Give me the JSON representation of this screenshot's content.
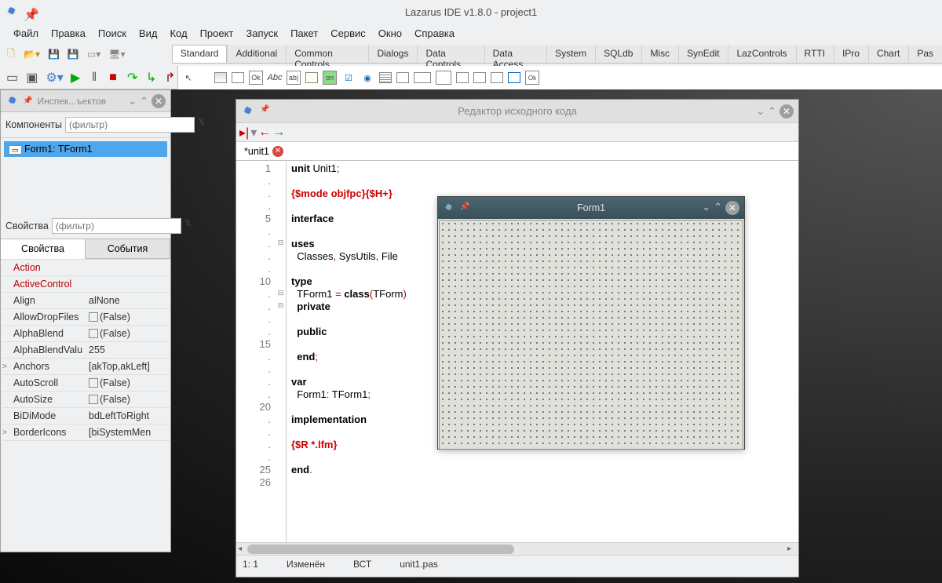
{
  "title": "Lazarus IDE v1.8.0 - project1",
  "menu": [
    "Файл",
    "Правка",
    "Поиск",
    "Вид",
    "Код",
    "Проект",
    "Запуск",
    "Пакет",
    "Сервис",
    "Окно",
    "Справка"
  ],
  "paletteTabs": [
    "Standard",
    "Additional",
    "Common Controls",
    "Dialogs",
    "Data Controls",
    "Data Access",
    "System",
    "SQLdb",
    "Misc",
    "SynEdit",
    "LazControls",
    "RTTI",
    "IPro",
    "Chart",
    "Pas"
  ],
  "paletteActive": "Standard",
  "inspector": {
    "title": "Инспек...ъектов",
    "componentsLabel": "Компоненты",
    "filterPlaceholder": "(фильтр)",
    "treeNode": "Form1: TForm1",
    "propertiesLabel": "Свойства",
    "tabs": [
      "Свойства",
      "События"
    ],
    "activeTab": "Свойства",
    "properties": [
      {
        "name": "Action",
        "value": "",
        "red": true,
        "exp": ""
      },
      {
        "name": "ActiveControl",
        "value": "",
        "red": true,
        "exp": ""
      },
      {
        "name": "Align",
        "value": "alNone",
        "exp": ""
      },
      {
        "name": "AllowDropFiles",
        "value": "(False)",
        "check": true,
        "exp": ""
      },
      {
        "name": "AlphaBlend",
        "value": "(False)",
        "check": true,
        "exp": ""
      },
      {
        "name": "AlphaBlendValu",
        "value": "255",
        "exp": ""
      },
      {
        "name": "Anchors",
        "value": "[akTop,akLeft]",
        "exp": ">"
      },
      {
        "name": "AutoScroll",
        "value": "(False)",
        "check": true,
        "exp": ""
      },
      {
        "name": "AutoSize",
        "value": "(False)",
        "check": true,
        "exp": ""
      },
      {
        "name": "BiDiMode",
        "value": "bdLeftToRight",
        "exp": ""
      },
      {
        "name": "BorderIcons",
        "value": "[biSystemMen",
        "exp": ">"
      }
    ]
  },
  "editor": {
    "title": "Редактор исходного кода",
    "tabName": "*unit1",
    "gutterLines": [
      "1",
      ".",
      ".",
      ".",
      "5",
      ".",
      ".",
      ".",
      ".",
      "10",
      ".",
      ".",
      ".",
      ".",
      "15",
      ".",
      ".",
      ".",
      ".",
      "20",
      ".",
      ".",
      ".",
      ".",
      "25",
      "26"
    ],
    "code": [
      {
        "t": "kw",
        "s": "unit "
      },
      {
        "t": "plain",
        "s": "Unit1"
      },
      {
        "t": "sym",
        "s": ";"
      },
      "\n",
      "\n",
      {
        "t": "dir",
        "s": "{$mode objfpc}{$H+}"
      },
      "\n",
      "\n",
      {
        "t": "kw",
        "s": "interface"
      },
      "\n",
      "\n",
      {
        "t": "kw",
        "s": "uses"
      },
      "\n",
      {
        "t": "plain",
        "s": "  Classes"
      },
      {
        "t": "sym",
        "s": ","
      },
      {
        "t": "plain",
        "s": " SysUtils"
      },
      {
        "t": "sym",
        "s": ","
      },
      {
        "t": "plain",
        "s": " File"
      },
      "\n",
      "\n",
      {
        "t": "kw",
        "s": "type"
      },
      "\n",
      {
        "t": "plain",
        "s": "  TForm1 "
      },
      {
        "t": "sym",
        "s": "="
      },
      {
        "t": "plain",
        "s": " "
      },
      {
        "t": "kw",
        "s": "class"
      },
      {
        "t": "sym",
        "s": "("
      },
      {
        "t": "plain",
        "s": "TForm"
      },
      {
        "t": "sym",
        "s": ")"
      },
      "\n",
      {
        "t": "plain",
        "s": "  "
      },
      {
        "t": "kw",
        "s": "private"
      },
      "\n",
      "\n",
      {
        "t": "plain",
        "s": "  "
      },
      {
        "t": "kw",
        "s": "public"
      },
      "\n",
      "\n",
      {
        "t": "plain",
        "s": "  "
      },
      {
        "t": "kw",
        "s": "end"
      },
      {
        "t": "sym",
        "s": ";"
      },
      "\n",
      "\n",
      {
        "t": "kw",
        "s": "var"
      },
      "\n",
      {
        "t": "plain",
        "s": "  Form1"
      },
      {
        "t": "sym",
        "s": ":"
      },
      {
        "t": "plain",
        "s": " TForm1"
      },
      {
        "t": "sym",
        "s": ";"
      },
      "\n",
      "\n",
      {
        "t": "kw",
        "s": "implementation"
      },
      "\n",
      "\n",
      {
        "t": "dir",
        "s": "{$R *.lfm}"
      },
      "\n",
      "\n",
      {
        "t": "kw",
        "s": "end"
      },
      {
        "t": "sym",
        "s": "."
      },
      "\n",
      "\n"
    ],
    "status": {
      "pos": "1: 1",
      "state": "Изменён",
      "ins": "ВСТ",
      "file": "unit1.pas"
    }
  },
  "formDesigner": {
    "title": "Form1"
  }
}
